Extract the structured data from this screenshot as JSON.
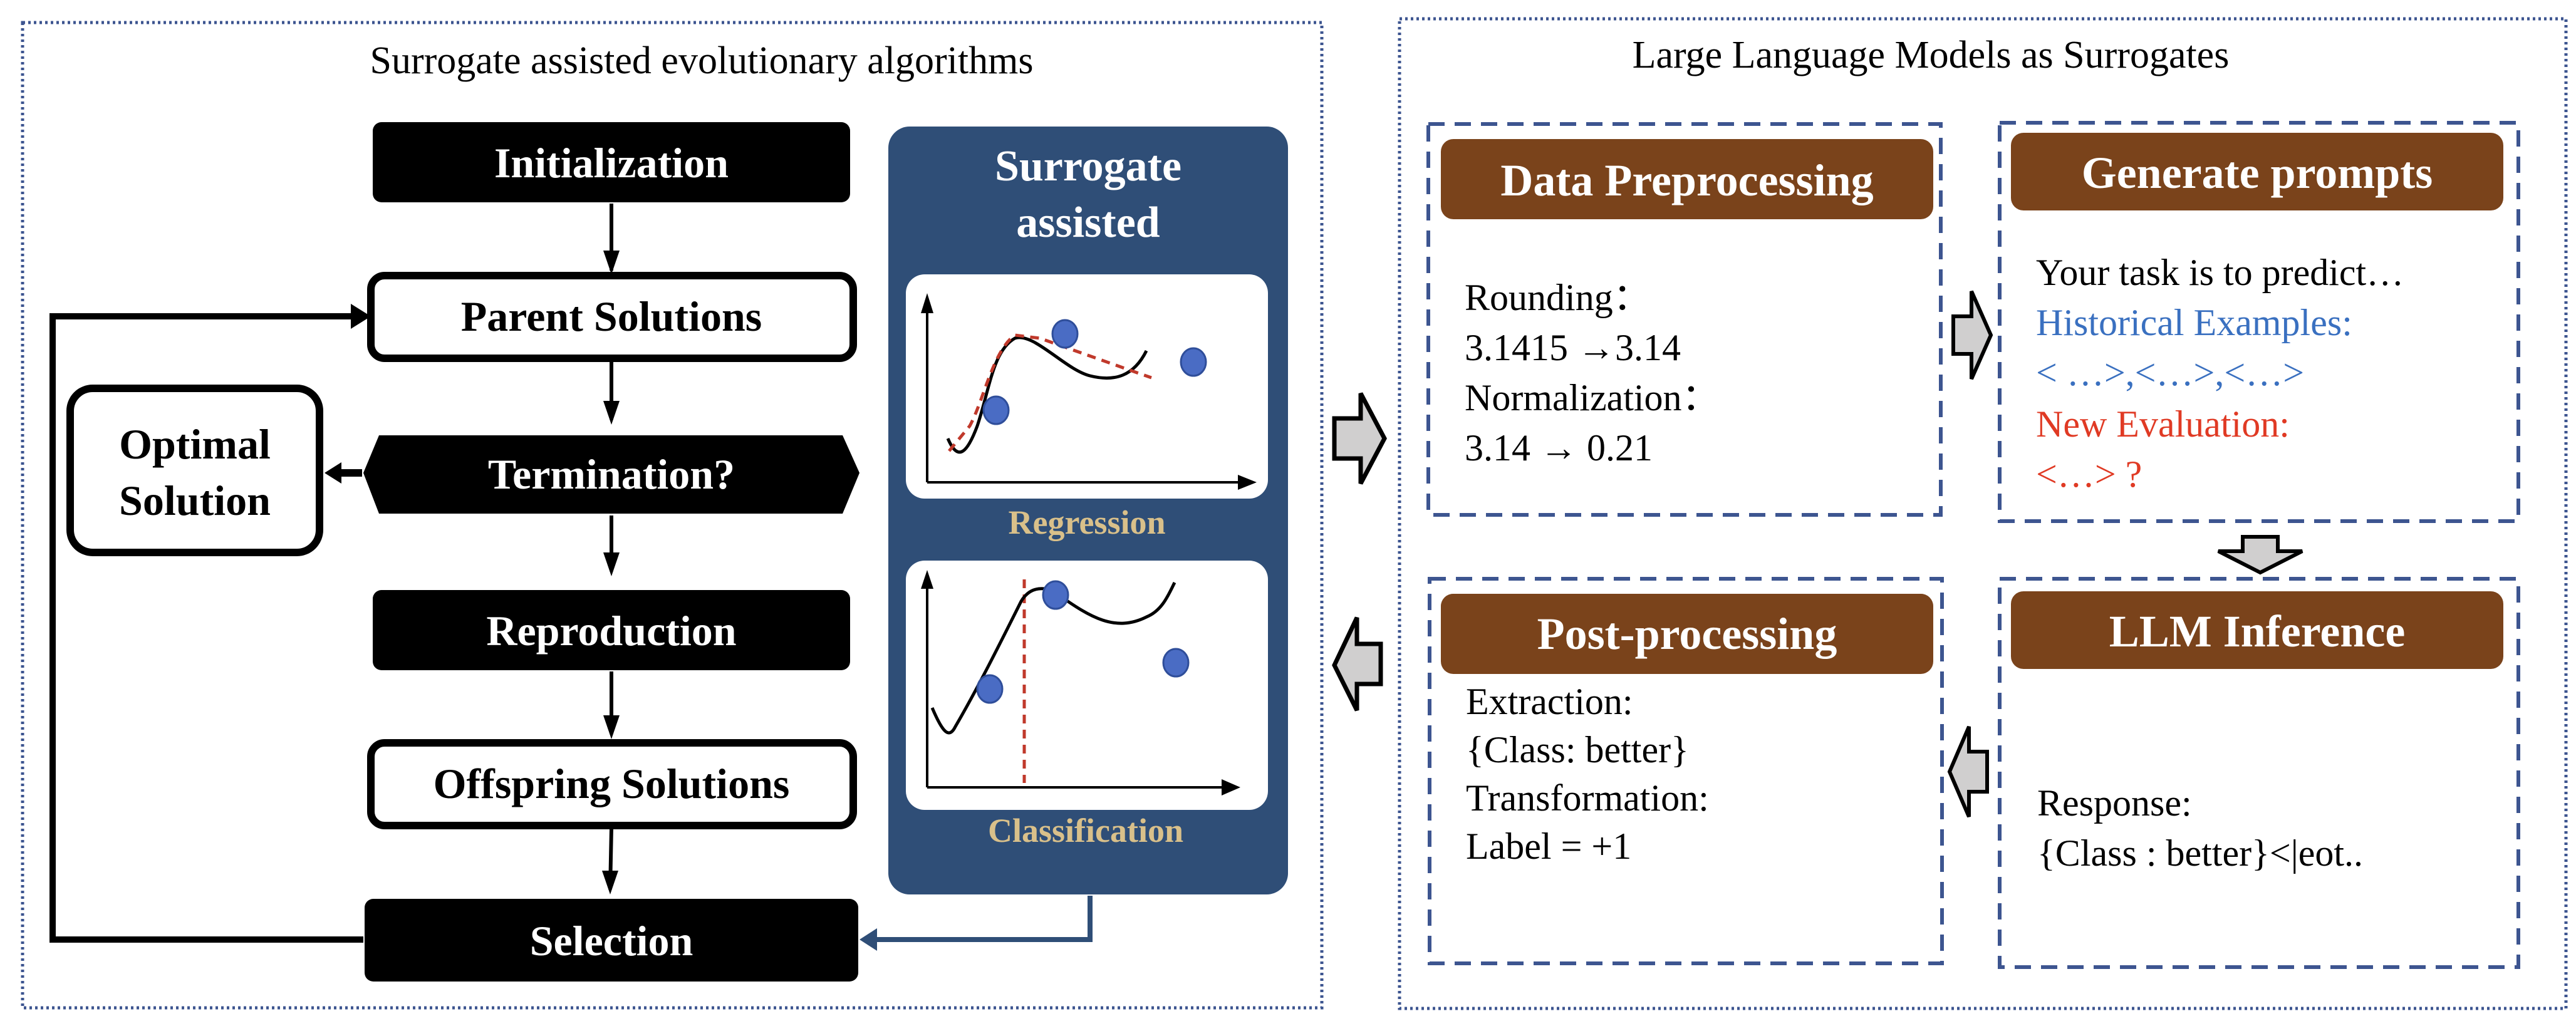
{
  "colors": {
    "panel_border": "#3d5590",
    "surrogate_bg": "#2f4e77",
    "brown_header": "#7a431b",
    "gold_label": "#d9c08a",
    "point_fill": "#4a6cc4",
    "dashed_red": "#c0392b",
    "blue_text": "#3a70c0",
    "red_text": "#e03a24",
    "gray_arrow": "#d0cfcf"
  },
  "left_panel": {
    "title": "Surrogate assisted evolutionary algorithms",
    "flow": {
      "initialization": "Initialization",
      "parent_solutions": "Parent Solutions",
      "termination": "Termination?",
      "optimal_solution_line1": "Optimal",
      "optimal_solution_line2": "Solution",
      "reproduction": "Reproduction",
      "offspring_solutions": "Offspring Solutions",
      "selection": "Selection"
    },
    "surrogate": {
      "title_line1": "Surrogate",
      "title_line2": "assisted",
      "regression_label": "Regression",
      "classification_label": "Classification"
    }
  },
  "right_panel": {
    "title": "Large Language Models as Surrogates",
    "data_preprocessing": {
      "header": "Data Preprocessing",
      "lines": [
        "Rounding：",
        "3.1415 →3.14",
        "Normalization：",
        "3.14 → 0.21"
      ]
    },
    "generate_prompts": {
      "header": "Generate prompts",
      "line_task": "Your task is to predict…",
      "line_hist_label": "Historical Examples:",
      "line_hist_values": "< …>,<…>,<…>",
      "line_new_label": "New Evaluation:",
      "line_new_value": "<…> ?"
    },
    "llm_inference": {
      "header": "LLM Inference",
      "lines": [
        "Response:",
        "{Class : better}<|eot.."
      ]
    },
    "post_processing": {
      "header": "Post-processing",
      "lines": [
        "Extraction:",
        "{Class: better}",
        "Transformation:",
        "Label = +1"
      ]
    }
  }
}
